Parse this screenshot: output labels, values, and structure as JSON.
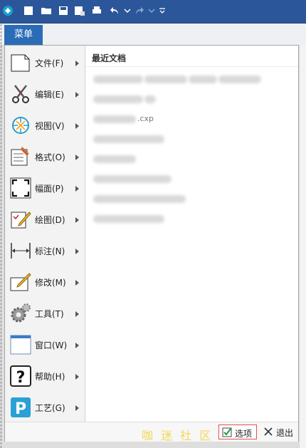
{
  "menu_tab": "菜单",
  "recent": {
    "title": "最近文档",
    "items": [
      {
        "visible_text": "",
        "blur_widths": [
          70,
          60,
          40,
          60
        ]
      },
      {
        "visible_text": "",
        "blur_widths": [
          70,
          16
        ]
      },
      {
        "visible_text": ".cxp",
        "blur_widths": [
          60
        ]
      },
      {
        "visible_text": "",
        "blur_widths": [
          100
        ]
      },
      {
        "visible_text": "",
        "blur_widths": [
          60
        ]
      },
      {
        "visible_text": "",
        "blur_widths": [
          110
        ]
      },
      {
        "visible_text": "",
        "blur_widths": [
          130
        ]
      },
      {
        "visible_text": "",
        "blur_widths": [
          100
        ]
      }
    ]
  },
  "menu_items": [
    {
      "label": "文件(F)",
      "icon": "file-icon"
    },
    {
      "label": "编辑(E)",
      "icon": "scissors-icon"
    },
    {
      "label": "视图(V)",
      "icon": "view-icon"
    },
    {
      "label": "格式(O)",
      "icon": "format-brush-icon"
    },
    {
      "label": "幅面(P)",
      "icon": "frame-icon"
    },
    {
      "label": "绘图(D)",
      "icon": "draw-icon"
    },
    {
      "label": "标注(N)",
      "icon": "dimension-icon"
    },
    {
      "label": "修改(M)",
      "icon": "modify-icon"
    },
    {
      "label": "工具(T)",
      "icon": "tools-gear-icon"
    },
    {
      "label": "窗口(W)",
      "icon": "window-icon"
    },
    {
      "label": "帮助(H)",
      "icon": "help-icon"
    },
    {
      "label": "工艺(G)",
      "icon": "process-icon"
    }
  ],
  "buttons": {
    "options": "选项",
    "exit": "退出"
  },
  "watermark": "咖 迷 社 区"
}
